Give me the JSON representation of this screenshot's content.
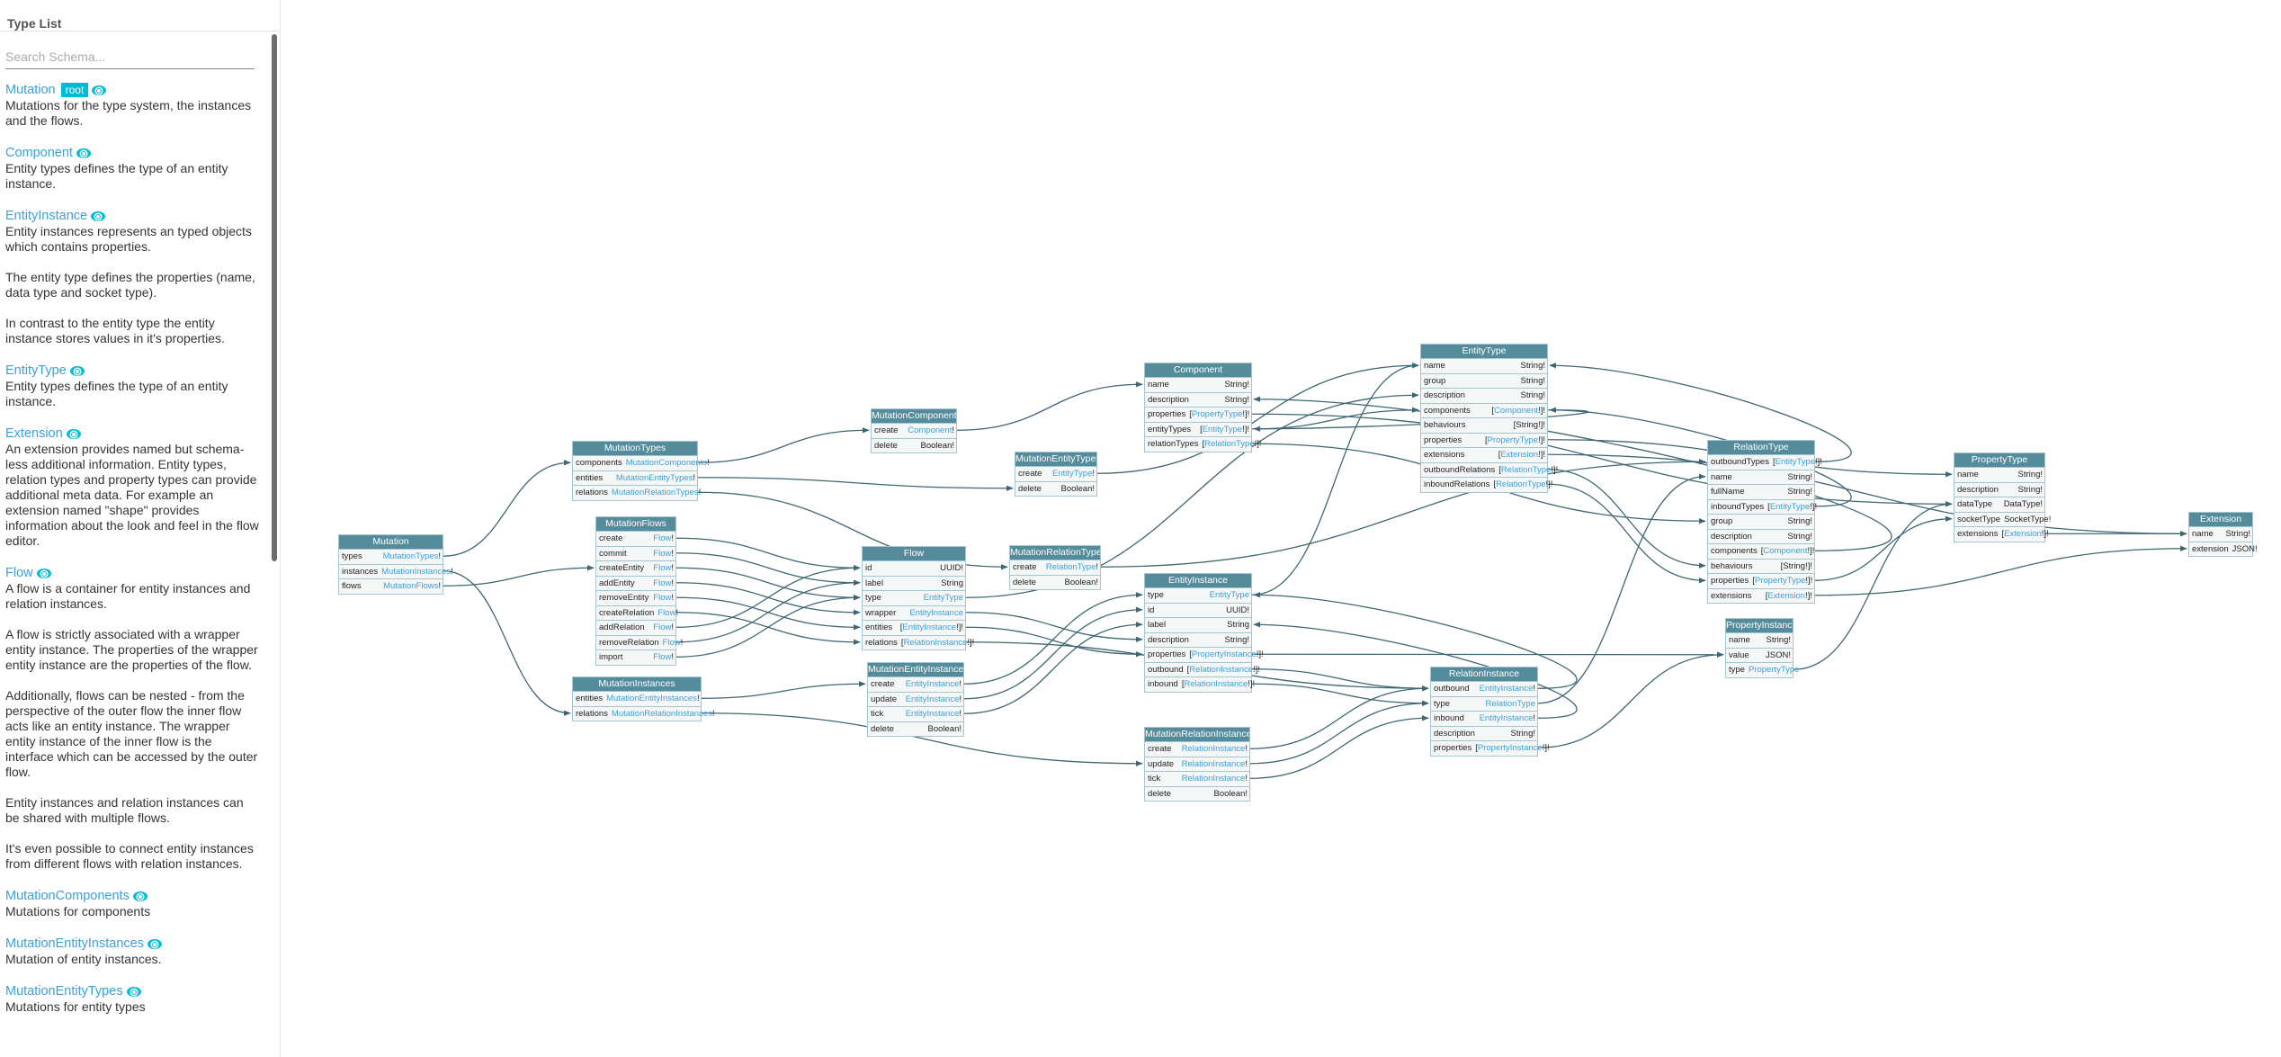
{
  "sidebar": {
    "title": "Type List",
    "search_placeholder": "Search Schema...",
    "items": [
      {
        "name": "Mutation",
        "badge": "root",
        "desc": [
          "Mutations for the type system, the instances and the flows."
        ]
      },
      {
        "name": "Component",
        "desc": [
          "Entity types defines the type of an entity instance."
        ]
      },
      {
        "name": "EntityInstance",
        "desc": [
          "Entity instances represents an typed objects which contains properties.",
          "The entity type defines the properties (name, data type and socket type).",
          "In contrast to the entity type the entity instance stores values in it's properties."
        ]
      },
      {
        "name": "EntityType",
        "desc": [
          "Entity types defines the type of an entity instance."
        ]
      },
      {
        "name": "Extension",
        "desc": [
          "An extension provides named but schema-less additional information. Entity types, relation types and property types can provide additional meta data. For example an extension named \"shape\" provides information about the look and feel in the flow editor."
        ]
      },
      {
        "name": "Flow",
        "desc": [
          "A flow is a container for entity instances and relation instances.",
          "A flow is strictly associated with a wrapper entity instance. The properties of the wrapper entity instance are the properties of the flow.",
          "Additionally, flows can be nested - from the perspective of the outer flow the inner flow acts like an entity instance. The wrapper entity instance of the inner flow is the interface which can be accessed by the outer flow.",
          "Entity instances and relation instances can be shared with multiple flows.",
          "It's even possible to connect entity instances from different flows with relation instances."
        ]
      },
      {
        "name": "MutationComponents",
        "desc": [
          "Mutations for components"
        ]
      },
      {
        "name": "MutationEntityInstances",
        "desc": [
          "Mutation of entity instances."
        ]
      },
      {
        "name": "MutationEntityTypes",
        "desc": [
          "Mutations for entity types"
        ]
      }
    ]
  },
  "graph": {
    "nodes": [
      {
        "id": "Mutation",
        "title": "Mutation",
        "fields": [
          {
            "name": "types",
            "type": "MutationTypes",
            "pre": "",
            "post": "!"
          },
          {
            "name": "instances",
            "type": "MutationInstances",
            "pre": "",
            "post": "!"
          },
          {
            "name": "flows",
            "type": "MutationFlows",
            "pre": "",
            "post": "!"
          }
        ]
      },
      {
        "id": "MutationTypes",
        "title": "MutationTypes",
        "fields": [
          {
            "name": "components",
            "type": "MutationComponents",
            "pre": "",
            "post": "!"
          },
          {
            "name": "entities",
            "type": "MutationEntityTypes",
            "pre": "",
            "post": "!"
          },
          {
            "name": "relations",
            "type": "MutationRelationTypes",
            "pre": "",
            "post": "!"
          }
        ]
      },
      {
        "id": "MutationFlows",
        "title": "MutationFlows",
        "fields": [
          {
            "name": "create",
            "type": "Flow",
            "pre": "",
            "post": "!"
          },
          {
            "name": "commit",
            "type": "Flow",
            "pre": "",
            "post": "!"
          },
          {
            "name": "createEntity",
            "type": "Flow",
            "pre": "",
            "post": "!"
          },
          {
            "name": "addEntity",
            "type": "Flow",
            "pre": "",
            "post": "!"
          },
          {
            "name": "removeEntity",
            "type": "Flow",
            "pre": "",
            "post": "!"
          },
          {
            "name": "createRelation",
            "type": "Flow",
            "pre": "",
            "post": "!"
          },
          {
            "name": "addRelation",
            "type": "Flow",
            "pre": "",
            "post": "!"
          },
          {
            "name": "removeRelation",
            "type": "Flow",
            "pre": "",
            "post": "!"
          },
          {
            "name": "import",
            "type": "Flow",
            "pre": "",
            "post": "!"
          }
        ]
      },
      {
        "id": "MutationInstances",
        "title": "MutationInstances",
        "fields": [
          {
            "name": "entities",
            "type": "MutationEntityInstances",
            "pre": "",
            "post": "!"
          },
          {
            "name": "relations",
            "type": "MutationRelationInstances",
            "pre": "",
            "post": "!"
          }
        ]
      },
      {
        "id": "MutationComponents",
        "title": "MutationComponents",
        "fields": [
          {
            "name": "create",
            "type": "Component",
            "pre": "",
            "post": "!"
          },
          {
            "name": "delete",
            "scalar": "Boolean!"
          }
        ]
      },
      {
        "id": "MutationEntityTypes",
        "title": "MutationEntityTypes",
        "fields": [
          {
            "name": "create",
            "type": "EntityType",
            "pre": "",
            "post": "!"
          },
          {
            "name": "delete",
            "scalar": "Boolean!"
          }
        ]
      },
      {
        "id": "Flow",
        "title": "Flow",
        "fields": [
          {
            "name": "id",
            "scalar": "UUID!"
          },
          {
            "name": "label",
            "scalar": "String"
          },
          {
            "name": "type",
            "type": "EntityType",
            "pre": "",
            "post": ""
          },
          {
            "name": "wrapper",
            "type": "EntityInstance",
            "pre": "",
            "post": ""
          },
          {
            "name": "entities",
            "type": "EntityInstance",
            "pre": "[",
            "post": "!]!"
          },
          {
            "name": "relations",
            "type": "RelationInstance",
            "pre": "[",
            "post": "!]!"
          }
        ]
      },
      {
        "id": "MutationEntityInstances",
        "title": "MutationEntityInstances",
        "fields": [
          {
            "name": "create",
            "type": "EntityInstance",
            "pre": "",
            "post": "!"
          },
          {
            "name": "update",
            "type": "EntityInstance",
            "pre": "",
            "post": "!"
          },
          {
            "name": "tick",
            "type": "EntityInstance",
            "pre": "",
            "post": "!"
          },
          {
            "name": "delete",
            "scalar": "Boolean!"
          }
        ]
      },
      {
        "id": "MutationRelationTypes",
        "title": "MutationRelationTypes",
        "fields": [
          {
            "name": "create",
            "type": "RelationType",
            "pre": "",
            "post": "!"
          },
          {
            "name": "delete",
            "scalar": "Boolean!"
          }
        ]
      },
      {
        "id": "Component",
        "title": "Component",
        "fields": [
          {
            "name": "name",
            "scalar": "String!"
          },
          {
            "name": "description",
            "scalar": "String!"
          },
          {
            "name": "properties",
            "type": "PropertyType",
            "pre": "[",
            "post": "!]!"
          },
          {
            "name": "entityTypes",
            "type": "EntityType",
            "pre": "[",
            "post": "!]!"
          },
          {
            "name": "relationTypes",
            "type": "RelationType",
            "pre": "[",
            "post": "!]!"
          }
        ]
      },
      {
        "id": "EntityInstance",
        "title": "EntityInstance",
        "fields": [
          {
            "name": "type",
            "type": "EntityType",
            "pre": "",
            "post": ""
          },
          {
            "name": "id",
            "scalar": "UUID!"
          },
          {
            "name": "label",
            "scalar": "String"
          },
          {
            "name": "description",
            "scalar": "String!"
          },
          {
            "name": "properties",
            "type": "PropertyInstance",
            "pre": "[",
            "post": "!]!"
          },
          {
            "name": "outbound",
            "type": "RelationInstance",
            "pre": "[",
            "post": "!]!"
          },
          {
            "name": "inbound",
            "type": "RelationInstance",
            "pre": "[",
            "post": "!]!"
          }
        ]
      },
      {
        "id": "MutationRelationInstances",
        "title": "MutationRelationInstances",
        "fields": [
          {
            "name": "create",
            "type": "RelationInstance",
            "pre": "",
            "post": "!"
          },
          {
            "name": "update",
            "type": "RelationInstance",
            "pre": "",
            "post": "!"
          },
          {
            "name": "tick",
            "type": "RelationInstance",
            "pre": "",
            "post": "!"
          },
          {
            "name": "delete",
            "scalar": "Boolean!"
          }
        ]
      },
      {
        "id": "EntityType",
        "title": "EntityType",
        "fields": [
          {
            "name": "name",
            "scalar": "String!"
          },
          {
            "name": "group",
            "scalar": "String!"
          },
          {
            "name": "description",
            "scalar": "String!"
          },
          {
            "name": "components",
            "type": "Component",
            "pre": "[",
            "post": "!]!"
          },
          {
            "name": "behaviours",
            "scalar": "[String!]!"
          },
          {
            "name": "properties",
            "type": "PropertyType",
            "pre": "[",
            "post": "!]!"
          },
          {
            "name": "extensions",
            "type": "Extension",
            "pre": "[",
            "post": "!]!"
          },
          {
            "name": "outboundRelations",
            "type": "RelationType",
            "pre": "[",
            "post": "!]!"
          },
          {
            "name": "inboundRelations",
            "type": "RelationType",
            "pre": "[",
            "post": "!]!"
          }
        ]
      },
      {
        "id": "RelationInstance",
        "title": "RelationInstance",
        "fields": [
          {
            "name": "outbound",
            "type": "EntityInstance",
            "pre": "",
            "post": "!"
          },
          {
            "name": "type",
            "type": "RelationType",
            "pre": "",
            "post": ""
          },
          {
            "name": "inbound",
            "type": "EntityInstance",
            "pre": "",
            "post": "!"
          },
          {
            "name": "description",
            "scalar": "String!"
          },
          {
            "name": "properties",
            "type": "PropertyInstance",
            "pre": "[",
            "post": "!]!"
          }
        ]
      },
      {
        "id": "RelationType",
        "title": "RelationType",
        "fields": [
          {
            "name": "outboundTypes",
            "type": "EntityType",
            "pre": "[",
            "post": "!]!"
          },
          {
            "name": "name",
            "scalar": "String!"
          },
          {
            "name": "fullName",
            "scalar": "String!"
          },
          {
            "name": "inboundTypes",
            "type": "EntityType",
            "pre": "[",
            "post": "!]!"
          },
          {
            "name": "group",
            "scalar": "String!"
          },
          {
            "name": "description",
            "scalar": "String!"
          },
          {
            "name": "components",
            "type": "Component",
            "pre": "[",
            "post": "!]!"
          },
          {
            "name": "behaviours",
            "scalar": "[String!]!"
          },
          {
            "name": "properties",
            "type": "PropertyType",
            "pre": "[",
            "post": "!]!"
          },
          {
            "name": "extensions",
            "type": "Extension",
            "pre": "[",
            "post": "!]!"
          }
        ]
      },
      {
        "id": "PropertyInstance",
        "title": "PropertyInstance",
        "fields": [
          {
            "name": "name",
            "scalar": "String!"
          },
          {
            "name": "value",
            "scalar": "JSON!"
          },
          {
            "name": "type",
            "type": "PropertyType",
            "pre": "",
            "post": ""
          }
        ]
      },
      {
        "id": "PropertyType",
        "title": "PropertyType",
        "fields": [
          {
            "name": "name",
            "scalar": "String!"
          },
          {
            "name": "description",
            "scalar": "String!"
          },
          {
            "name": "dataType",
            "scalar": "DataType!"
          },
          {
            "name": "socketType",
            "scalar": "SocketType!"
          },
          {
            "name": "extensions",
            "type": "Extension",
            "pre": "[",
            "post": "!]!"
          }
        ]
      },
      {
        "id": "Extension",
        "title": "Extension",
        "fields": [
          {
            "name": "name",
            "scalar": "String!"
          },
          {
            "name": "extension",
            "scalar": "JSON!"
          }
        ]
      }
    ]
  },
  "colors": {
    "node_header": "#548c9b",
    "node_border": "#a4c6d2",
    "link_type": "#3ba0d8",
    "edge": "#3f6673",
    "accent": "#00bcd4"
  }
}
